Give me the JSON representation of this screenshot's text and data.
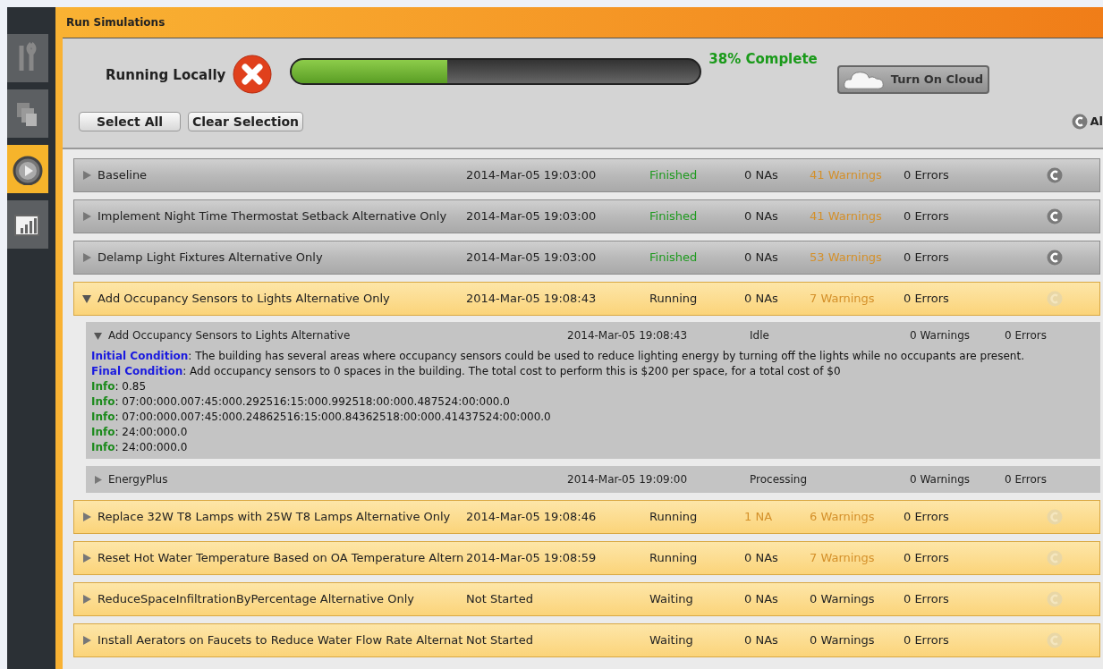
{
  "nav": [
    {
      "kind": "tools",
      "selected": false
    },
    {
      "kind": "pages",
      "selected": false
    },
    {
      "kind": "play",
      "selected": true
    },
    {
      "kind": "chart",
      "selected": false
    }
  ],
  "title": "Run Simulations",
  "toolbar": {
    "run_label": "Running Locally",
    "progress": {
      "level": 0.38,
      "reading": "38% Complete"
    },
    "cloud_button": "Turn On Cloud",
    "select_all": "Select All",
    "clear_selection": "Clear Selection",
    "cancel_all": "Al"
  },
  "rows": [
    {
      "name": "Baseline",
      "time": "2014-Mar-05 19:03:00",
      "status": "Finished",
      "kind": "finished",
      "expanded": false,
      "nas": "0 NAs",
      "nas_flagged": false,
      "warnings": "41 Warnings",
      "warnings_flagged": true,
      "errors": "0 Errors"
    },
    {
      "name": "Implement Night Time Thermostat Setback Alternative Only",
      "time": "2014-Mar-05 19:03:00",
      "status": "Finished",
      "kind": "finished",
      "expanded": false,
      "nas": "0 NAs",
      "nas_flagged": false,
      "warnings": "41 Warnings",
      "warnings_flagged": true,
      "errors": "0 Errors"
    },
    {
      "name": "Delamp Light Fixtures Alternative Only",
      "time": "2014-Mar-05 19:03:00",
      "status": "Finished",
      "kind": "finished",
      "expanded": false,
      "nas": "0 NAs",
      "nas_flagged": false,
      "warnings": "53 Warnings",
      "warnings_flagged": true,
      "errors": "0 Errors"
    },
    {
      "name": "Add Occupancy Sensors to Lights Alternative Only",
      "time": "2014-Mar-05 19:08:43",
      "status": "Running",
      "kind": "running",
      "expanded": true,
      "nas": "0 NAs",
      "nas_flagged": false,
      "warnings": "7 Warnings",
      "warnings_flagged": true,
      "errors": "0 Errors",
      "children": [
        {
          "name": "Add Occupancy Sensors to Lights Alternative",
          "time": "2014-Mar-05 19:08:43",
          "status": "Idle",
          "warnings": "0 Warnings",
          "errors": "0 Errors",
          "expanded": true,
          "messages": [
            {
              "kind": "condition",
              "text": "**Initial Condition**: The building has several areas where occupancy sensors could be used to reduce lighting energy by turning off the lights while no occupants are present."
            },
            {
              "kind": "condition",
              "text": "**Final Condition**: Add occupancy sensors to 0 spaces in the building. The total cost to perform this is $200 per space, for a total cost of $0"
            },
            {
              "kind": "info",
              "text": "**Info**: 0.85"
            },
            {
              "kind": "info",
              "text": "**Info**: 07:00:000.007:45:000.292516:15:000.992518:00:000.487524:00:000.0"
            },
            {
              "kind": "info",
              "text": "**Info**: 07:00:000.007:45:000.24862516:15:000.84362518:00:000.41437524:00:000.0"
            },
            {
              "kind": "info",
              "text": "**Info**: 24:00:000.0"
            },
            {
              "kind": "info",
              "text": "**Info**: 24:00:000.0"
            }
          ]
        },
        {
          "name": "EnergyPlus",
          "time": "2014-Mar-05 19:09:00",
          "status": "Processing",
          "warnings": "0 Warnings",
          "errors": "0 Errors",
          "expanded": false
        }
      ]
    },
    {
      "name": "Replace 32W T8 Lamps with 25W T8 Lamps Alternative Only",
      "time": "2014-Mar-05 19:08:46",
      "status": "Running",
      "kind": "running",
      "expanded": false,
      "nas": "1 NA",
      "nas_flagged": true,
      "warnings": "6 Warnings",
      "warnings_flagged": true,
      "errors": "0 Errors"
    },
    {
      "name": "Reset Hot Water Temperature Based on OA Temperature Altern",
      "time": "2014-Mar-05 19:08:59",
      "status": "Running",
      "kind": "running",
      "expanded": false,
      "nas": "0 NAs",
      "nas_flagged": false,
      "warnings": "7 Warnings",
      "warnings_flagged": true,
      "errors": "0 Errors"
    },
    {
      "name": "ReduceSpaceInfiltrationByPercentage Alternative Only",
      "time": "Not Started",
      "status": "Waiting",
      "kind": "waiting",
      "expanded": false,
      "nas": "0 NAs",
      "nas_flagged": false,
      "warnings": "0 Warnings",
      "warnings_flagged": false,
      "errors": "0 Errors"
    },
    {
      "name": "Install Aerators on Faucets to Reduce Water Flow Rate Alternat",
      "time": "Not Started",
      "status": "Waiting",
      "kind": "waiting",
      "expanded": false,
      "nas": "0 NAs",
      "nas_flagged": false,
      "warnings": "0 Warnings",
      "warnings_flagged": false,
      "errors": "0 Errors"
    }
  ]
}
